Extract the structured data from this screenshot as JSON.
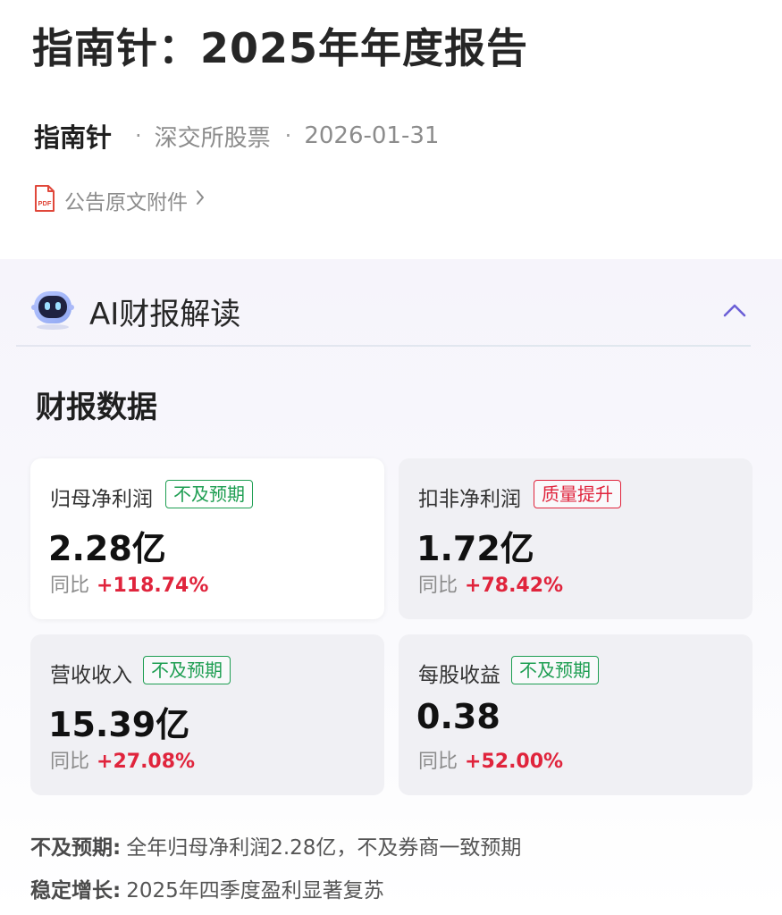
{
  "header": {
    "title": "指南针：2025年年度报告",
    "company": "指南针",
    "exchange": "深交所股票",
    "date": "2026-01-31",
    "attachment_label": "公告原文附件",
    "attachment_icon": "pdf-file-icon",
    "attachment_icon_text": "PDF"
  },
  "ai": {
    "title": "AI财报解读",
    "icon": "robot-icon"
  },
  "section": {
    "title": "财报数据"
  },
  "cards": [
    {
      "name": "归母净利润",
      "badge": "不及预期",
      "value": "2.28亿",
      "yoy_label": "同比",
      "yoy_value": "+118.74%"
    },
    {
      "name": "扣非净利润",
      "badge": "质量提升",
      "value": "1.72亿",
      "yoy_label": "同比",
      "yoy_value": "+78.42%"
    },
    {
      "name": "营收收入",
      "badge": "不及预期",
      "value": "15.39亿",
      "yoy_label": "同比",
      "yoy_value": "+27.08%"
    },
    {
      "name": "每股收益",
      "badge": "不及预期",
      "value": "0.38",
      "yoy_label": "同比",
      "yoy_value": "+52.00%"
    }
  ],
  "notes": [
    {
      "label": "不及预期:",
      "text": "全年归母净利润2.28亿，不及券商一致预期"
    },
    {
      "label": "稳定增长:",
      "text": "2025年四季度盈利显著复苏"
    }
  ],
  "colors": {
    "positive": "#e0243c",
    "badge_green": "#1e9e52",
    "badge_red": "#e0243c",
    "accent": "#6b5fd6"
  }
}
